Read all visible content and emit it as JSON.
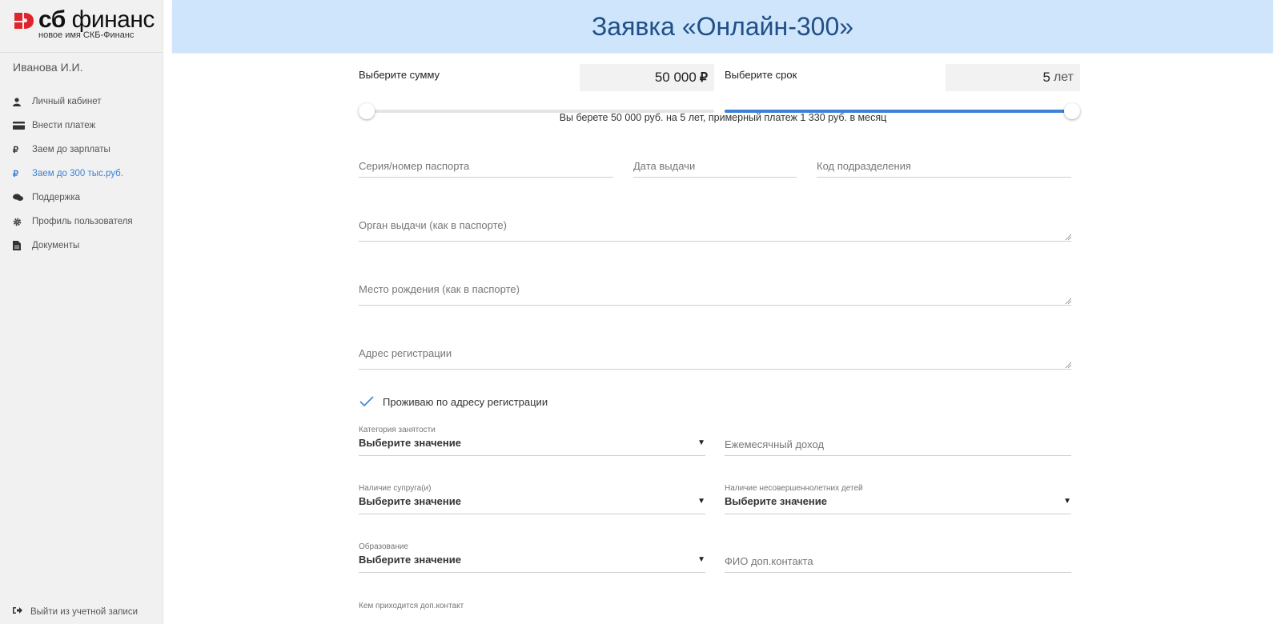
{
  "brand": {
    "name_bold": "сб",
    "name_light": "финанс",
    "tagline": "новое имя СКБ-Финанс",
    "color": "#e0242d"
  },
  "user": {
    "name": "Иванова И.И."
  },
  "menu": [
    {
      "label": "Личный кабинет",
      "icon": "user-icon"
    },
    {
      "label": "Внести платеж",
      "icon": "credit-card-icon"
    },
    {
      "label": "Заем до зарплаты",
      "icon": "ruble-icon"
    },
    {
      "label": "Заем до 300 тыс.руб.",
      "icon": "ruble-icon",
      "active": true
    },
    {
      "label": "Поддержка",
      "icon": "comments-icon"
    },
    {
      "label": "Профиль пользователя",
      "icon": "gear-icon"
    },
    {
      "label": "Документы",
      "icon": "document-icon"
    }
  ],
  "logout": {
    "label": "Выйти из учетной записи",
    "icon": "sign-out-icon"
  },
  "header": {
    "title": "Заявка «Онлайн-300»"
  },
  "amount": {
    "label": "Выберите сумму",
    "value": "50 000",
    "unit": "₽",
    "position": 0
  },
  "term": {
    "label": "Выберите срок",
    "value": "5",
    "unit": "лет",
    "position": 1
  },
  "summary": "Вы берете 50 000 руб. на 5  лет, примерный платеж 1 330 руб. в месяц",
  "fields": {
    "passport": "Серия/номер паспорта",
    "issue_date": "Дата выдачи",
    "division_code": "Код подразделения",
    "issuer": "Орган выдачи (как в паспорте)",
    "birthplace": "Место рождения (как в паспорте)",
    "reg_address": "Адрес регистрации",
    "monthly_income": "Ежемесячный доход",
    "extra_contact_name": "ФИО доп.контакта"
  },
  "checkbox": {
    "label": "Проживаю по адресу регистрации",
    "checked": true
  },
  "selects": {
    "employment": {
      "label": "Категория занятости",
      "value": "Выберите значение"
    },
    "spouse": {
      "label": "Наличие супруга(и)",
      "value": "Выберите значение"
    },
    "children": {
      "label": "Наличие несовершеннолетних детей",
      "value": "Выберите значение"
    },
    "education": {
      "label": "Образование",
      "value": "Выберите значение"
    }
  },
  "extra_contact_relation_label": "Кем приходится доп.контакт",
  "colors": {
    "accent": "#3d82d6",
    "header_bg": "#cfe5fb",
    "header_text": "#1f4f86"
  }
}
